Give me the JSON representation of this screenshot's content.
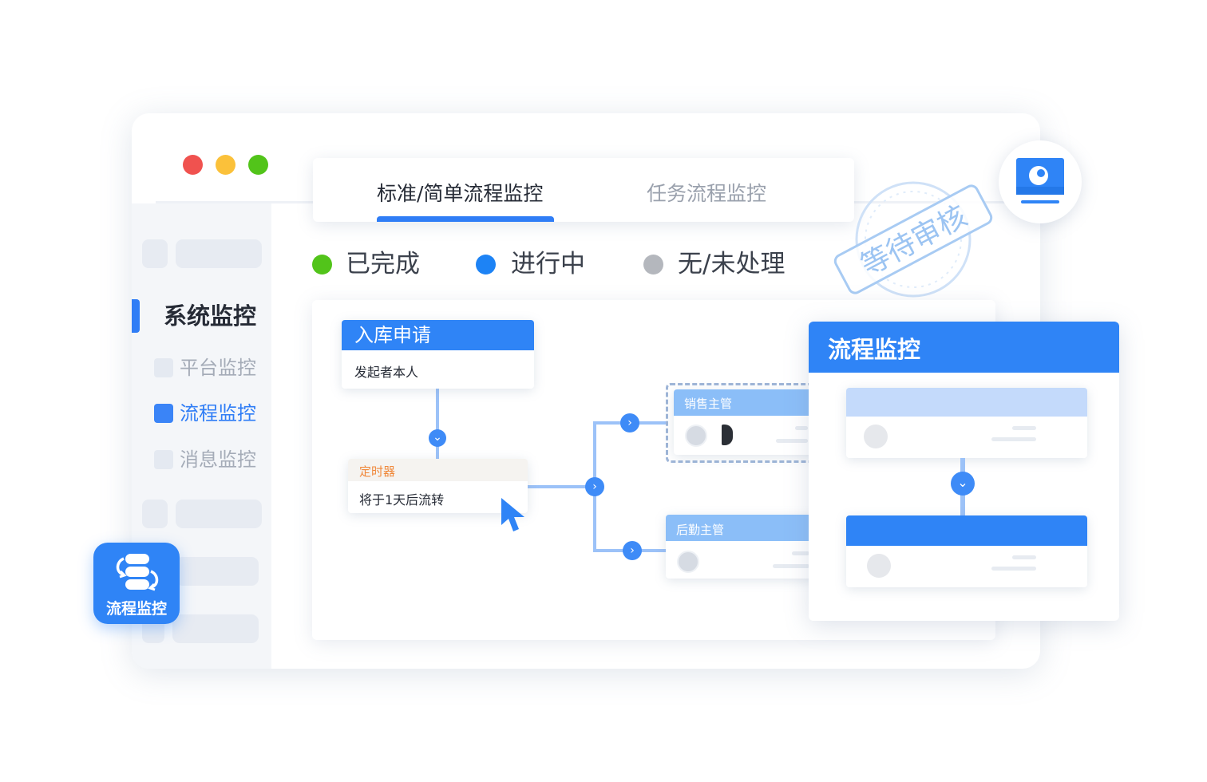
{
  "window": {
    "traffic_lights": [
      "#f0524f",
      "#fbc13a",
      "#52c41a"
    ]
  },
  "sidebar": {
    "title": "系统监控",
    "items": [
      {
        "label": "平台监控",
        "active": false
      },
      {
        "label": "流程监控",
        "active": true
      },
      {
        "label": "消息监控",
        "active": false
      }
    ]
  },
  "float_button": {
    "label": "流程监控",
    "icon": "flow-cycle-icon"
  },
  "tabs": [
    {
      "label": "标准/简单流程监控",
      "active": true
    },
    {
      "label": "任务流程监控",
      "active": false
    }
  ],
  "legend": [
    {
      "label": "已完成",
      "color": "#52c41a"
    },
    {
      "label": "进行中",
      "color": "#1d83f5"
    },
    {
      "label": "无/未处理",
      "color": "#b4b7bd"
    }
  ],
  "stamp": {
    "text": "等待审核",
    "color": "#9cc4f2"
  },
  "monitor_icon": "monitor-icon",
  "flow": {
    "start_node": {
      "title": "入库申请",
      "body": "发起者本人"
    },
    "timer_node": {
      "title": "定时器",
      "body": "将于1天后流转"
    },
    "sales_node": {
      "title": "销售主管"
    },
    "logistics_node": {
      "title": "后勤主管"
    }
  },
  "right_card": {
    "title": "流程监控"
  },
  "colors": {
    "accent": "#2f84f6",
    "timer_orange": "#f0883a"
  }
}
